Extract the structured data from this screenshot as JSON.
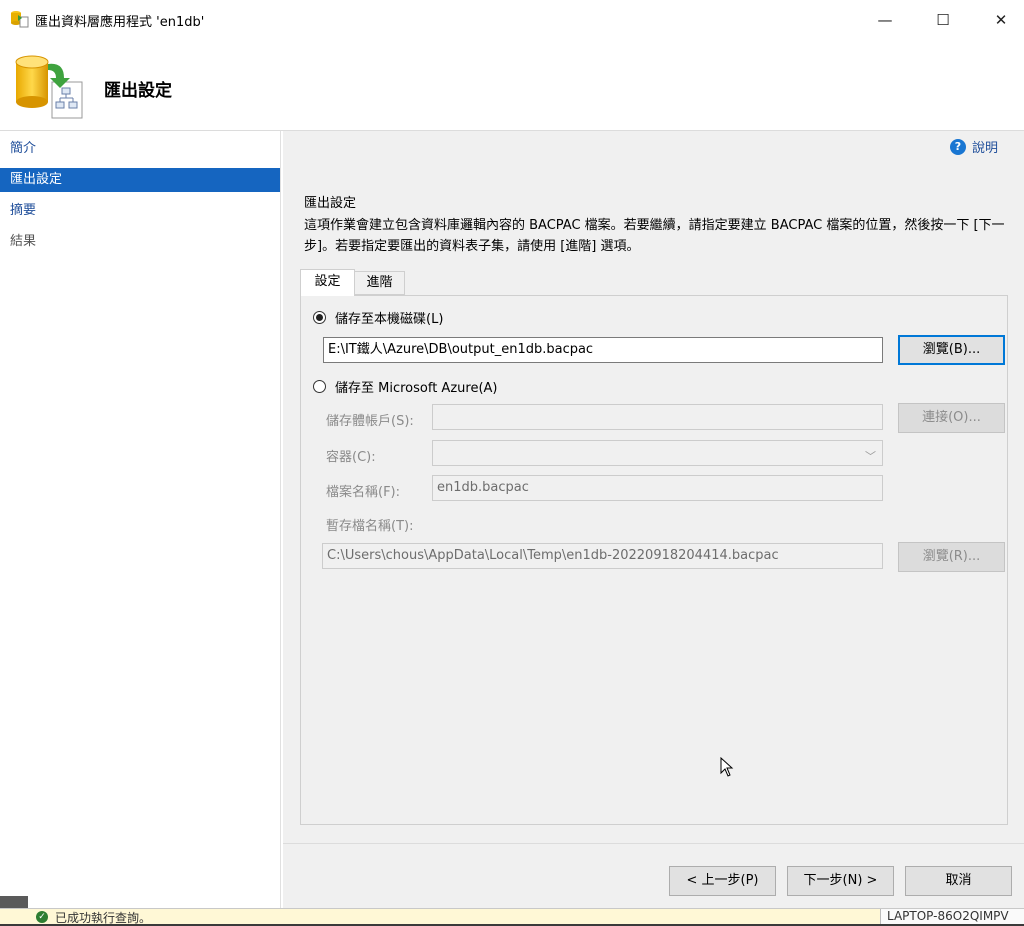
{
  "window": {
    "title": "匯出資料層應用程式 'en1db'",
    "minimize": "—",
    "maximize": "☐",
    "close": "✕"
  },
  "header": {
    "title": "匯出設定"
  },
  "nav": {
    "items": [
      {
        "label": "簡介",
        "state": "link"
      },
      {
        "label": "匯出設定",
        "state": "selected"
      },
      {
        "label": "摘要",
        "state": "link"
      },
      {
        "label": "結果",
        "state": "disabled"
      }
    ]
  },
  "help": {
    "label": "說明"
  },
  "section": {
    "title": "匯出設定",
    "description": "這項作業會建立包含資料庫邏輯內容的 BACPAC 檔案。若要繼續，請指定要建立 BACPAC 檔案的位置，然後按一下 [下一步]。若要指定要匯出的資料表子集，請使用 [進階] 選項。"
  },
  "tabs": [
    {
      "label": "設定",
      "active": true
    },
    {
      "label": "進階",
      "active": false
    }
  ],
  "local": {
    "radio_label": "儲存至本機磁碟(L)",
    "selected": true,
    "path_value": "E:\\IT鐵人\\Azure\\DB\\output_en1db.bacpac",
    "browse_label": "瀏覽(B)..."
  },
  "azure": {
    "radio_label": "儲存至 Microsoft Azure(A)",
    "selected": false,
    "storage_account_label": "儲存體帳戶(S):",
    "storage_account_value": "",
    "connect_label": "連接(O)...",
    "container_label": "容器(C):",
    "container_value": "",
    "filename_label": "檔案名稱(F):",
    "filename_value": "en1db.bacpac",
    "temp_label": "暫存檔名稱(T):",
    "temp_value": "C:\\Users\\chous\\AppData\\Local\\Temp\\en1db-20220918204414.bacpac",
    "temp_browse_label": "瀏覽(R)..."
  },
  "footer": {
    "back": "< 上一步(P)",
    "next": "下一步(N) >",
    "cancel": "取消"
  },
  "statusbar": {
    "message": "已成功執行查詢。",
    "host": "LAPTOP-86O2QIMPV"
  },
  "colors": {
    "selection": "#1565c0",
    "link": "#1f4e9a",
    "focus": "#0078d7"
  }
}
